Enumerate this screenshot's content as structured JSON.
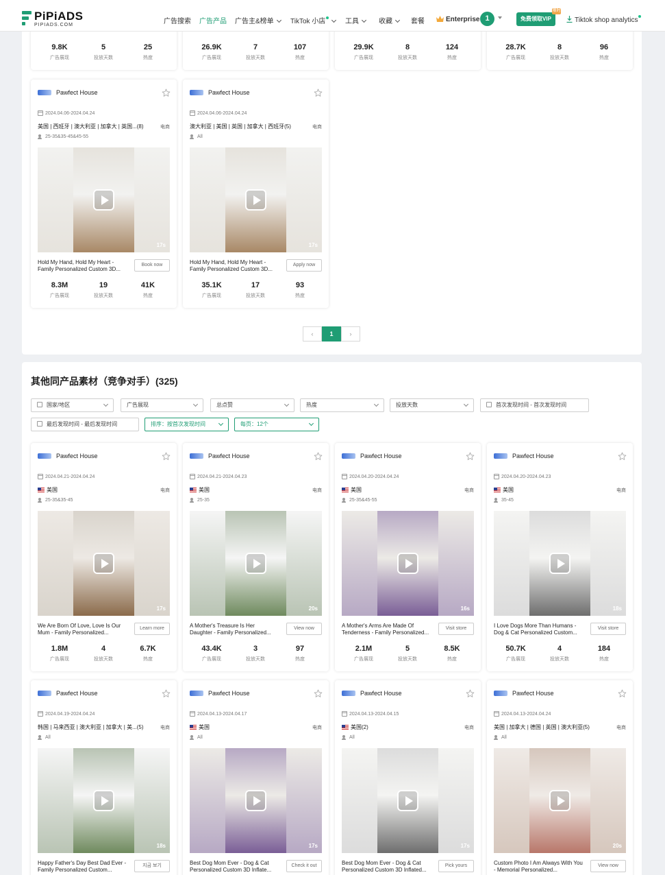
{
  "header": {
    "logo_brand": "PiPiADS",
    "logo_sub": "PIPIADS.COM",
    "nav": [
      "广告搜索",
      "广告产品",
      "广告主&榜单",
      "TikTok 小店",
      "工具",
      "收藏",
      "套餐"
    ],
    "enterprise": "Enterprise",
    "notification_count": "1",
    "vip_button": "免费领取VIP",
    "vip_flag": "限时",
    "tiktok_analytics": "Tiktok shop analytics",
    "accent_color": "#1f9d74"
  },
  "top_stats_row": [
    {
      "v1": "9.8K",
      "v2": "5",
      "v3": "25"
    },
    {
      "v1": "26.9K",
      "v2": "7",
      "v3": "107"
    },
    {
      "v1": "29.9K",
      "v2": "8",
      "v3": "124"
    },
    {
      "v1": "28.7K",
      "v2": "8",
      "v3": "96"
    }
  ],
  "stat_labels": {
    "impressions": "广告展现",
    "days": "投放天数",
    "heat": "热度"
  },
  "ecom_label": "电商",
  "upper_cards": [
    {
      "shop": "Pawfect House",
      "date": "2024.04.06-2024.04.24",
      "region": "美国 | 西班牙 | 澳大利亚 | 加拿大 | 英国...(8)",
      "age": "25-35&35-45&45-55",
      "duration": "17s",
      "title": "Hold My Hand, Hold My Heart - Family Personalized Custom 3D...",
      "cta": "Book now",
      "impressions": "8.3M",
      "days": "19",
      "heat": "41K"
    },
    {
      "shop": "Pawfect House",
      "date": "2024.04.06-2024.04.24",
      "region": "澳大利亚 | 美国 | 英国 | 加拿大 | 西班牙(5)",
      "age": "All",
      "duration": "17s",
      "title": "Hold My Hand, Hold My Heart - Family Personalized Custom 3D...",
      "cta": "Apply now",
      "impressions": "35.1K",
      "days": "17",
      "heat": "93"
    }
  ],
  "pagination": {
    "prev": "‹",
    "current": "1",
    "next": "›"
  },
  "competitor_section": {
    "title": "其他同产品素材（竞争对手）(325)",
    "filters": {
      "country": "国家/地区",
      "impressions": "广告展现",
      "likes": "总点赞",
      "heat": "热度",
      "days": "投放天数",
      "first_seen": "首次发现时间  -  首次发现时间",
      "last_seen": "最后发现时间  -  最后发现时间",
      "sort": "排序：按首次发现时间",
      "per_page": "每页：12个"
    }
  },
  "cards_row1": [
    {
      "shop": "Pawfect House",
      "date": "2024.04.21-2024.04.24",
      "region": "美国",
      "age": "25-35&35-45",
      "duration": "17s",
      "title": "We Are Born Of Love, Love Is Our Mum - Family Personalized...",
      "cta": "Learn more",
      "impressions": "1.8M",
      "days": "4",
      "heat": "6.7K"
    },
    {
      "shop": "Pawfect House",
      "date": "2024.04.21-2024.04.23",
      "region": "美国",
      "age": "25-35",
      "duration": "20s",
      "title": "A Mother's Treasure Is Her Daughter - Family Personalized...",
      "cta": "View now",
      "impressions": "43.4K",
      "days": "3",
      "heat": "97"
    },
    {
      "shop": "Pawfect House",
      "date": "2024.04.20-2024.04.24",
      "region": "美国",
      "age": "25-35&45-55",
      "duration": "16s",
      "title": "A Mother's Arms Are Made Of Tenderness - Family Personalized...",
      "cta": "Visit store",
      "impressions": "2.1M",
      "days": "5",
      "heat": "8.5K"
    },
    {
      "shop": "Pawfect House",
      "date": "2024.04.20-2024.04.23",
      "region": "美国",
      "age": "35-45",
      "duration": "18s",
      "title": "I Love Dogs More Than Humans - Dog & Cat Personalized Custom...",
      "cta": "Visit store",
      "impressions": "50.7K",
      "days": "4",
      "heat": "184"
    }
  ],
  "cards_row2": [
    {
      "shop": "Pawfect House",
      "date": "2024.04.19-2024.04.24",
      "region": "韩国 | 马来西亚 | 澳大利亚 | 加拿大 | 美...(5)",
      "age": "All",
      "duration": "18s",
      "title": "Happy Father's Day Best Dad Ever - Family Personalized Custom...",
      "cta": "지금 보기"
    },
    {
      "shop": "Pawfect House",
      "date": "2024.04.13-2024.04.17",
      "region": "美国",
      "age": "All",
      "duration": "17s",
      "title": "Best Dog Mom Ever - Dog & Cat Personalized Custom 3D Inflate...",
      "cta": "Check it out"
    },
    {
      "shop": "Pawfect House",
      "date": "2024.04.13-2024.04.15",
      "region": "美国(2)",
      "age": "All",
      "duration": "17s",
      "title": "Best Dog Mom Ever - Dog & Cat Personalized Custom 3D Inflated...",
      "cta": "Pick yours"
    },
    {
      "shop": "Pawfect House",
      "date": "2024.04.13-2024.04.24",
      "region": "美国 | 加拿大 | 德国 | 英国 | 澳大利亚(5)",
      "age": "All",
      "duration": "20s",
      "title": "Custom Photo I Am Always With You - Memorial Personalized...",
      "cta": "View now"
    }
  ]
}
